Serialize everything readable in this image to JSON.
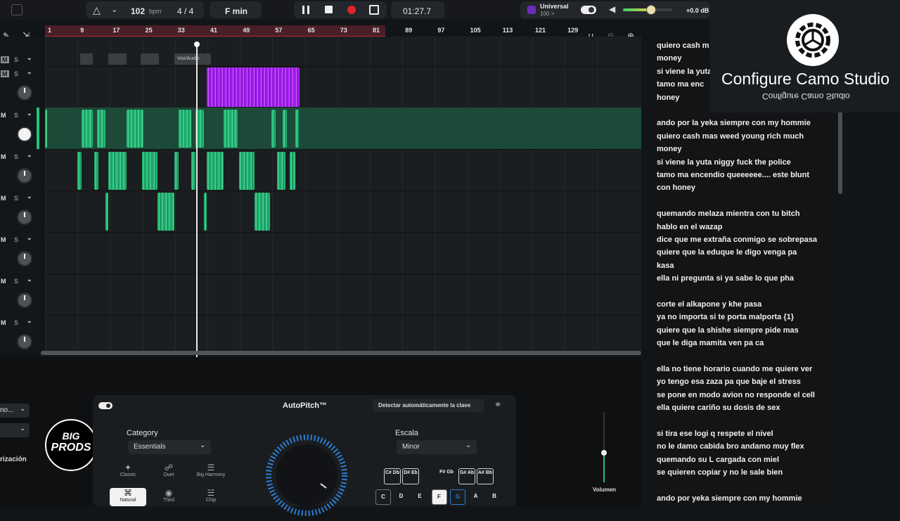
{
  "transport": {
    "bpm_value": "102",
    "bpm_unit": "bpm",
    "time_signature": "4 / 4",
    "key": "F min",
    "time": "01:27.7",
    "universal_label": "Universal",
    "universal_value": "100 >",
    "master_gain": "+0.0 dB",
    "volume_level": 0.55
  },
  "ruler": {
    "ticks": [
      "1",
      "9",
      "17",
      "25",
      "33",
      "41",
      "49",
      "57",
      "65",
      "73",
      "81",
      "89",
      "97",
      "105",
      "113",
      "121",
      "129"
    ]
  },
  "timeline": {
    "clip_label": "Voz/Audio"
  },
  "tracks": [
    {
      "m": "M",
      "s": "S"
    },
    {
      "m": "M",
      "s": "S"
    },
    {
      "m": "M",
      "s": "S"
    },
    {
      "m": "M",
      "s": "S"
    },
    {
      "m": "M",
      "s": "S"
    },
    {
      "m": "M",
      "s": "S"
    },
    {
      "m": "M",
      "s": "S"
    },
    {
      "m": "M",
      "s": "S"
    }
  ],
  "camo": {
    "title": "Configure Camo Studio",
    "subtitle": "Configure Camo Studio"
  },
  "lyrics": [
    "quiero cash m",
    "money",
    "si viene la yuta",
    " tamo ma enc",
    "honey",
    "",
    " ando por la  yeka siempre con my hommie",
    "quiero cash mas weed  young rich  much",
    "money",
    "si viene la yuta niggy fuck the police",
    " tamo ma encendio queeeeee.... este blunt",
    "con honey",
    "",
    "quemando melaza mientra con tu bitch",
    "hablo en el wazap",
    "dice que me extraña conmigo se sobrepasa",
    " quiere que la eduque le digo venga pa",
    "kasa",
    "ella ni pregunta si ya sabe lo que pha",
    "",
    " corte el alkapone y khe pasa",
    "ya no importa si te porta malporta {1}",
    "quiere que la shishe siempre pide mas",
    "que  le diga mamita ven  pa ca",
    "",
    "ella no tiene horario cuando me quiere ver",
    "yo tengo esa zaza pa que baje el stress",
    " se pone en  modo avion no responde el cell",
    "ella quiere cariño su dosis de sex",
    "",
    "si tira ese logi q respete el nivel",
    "no le damo cabida bro andamo muy flex",
    "quemando su L cargada con miel",
    "se quieren copiar y no le sale bien",
    "",
    "ando por yeka siempre con my hommie"
  ],
  "bottom": {
    "left_dropdown1": "no...",
    "left_label": "rización",
    "logo_text_1": "BIG",
    "logo_text_2": "PRODS",
    "plugin_title": "AutoPitch™",
    "detect_key": "Detectar automáticamente la clave",
    "category_label": "Category",
    "category_value": "Essentials",
    "scale_label": "Escala",
    "scale_value": "Minor",
    "styles": [
      "Classic",
      "Duet",
      "Big Harmony",
      "Natural",
      "Third",
      "Chip"
    ],
    "sharps": [
      "C#\nDb",
      "D#\nEb",
      "F#\nGb",
      "G#\nAb",
      "A#\nBb"
    ],
    "naturals": [
      "C",
      "D",
      "E",
      "F",
      "G",
      "A",
      "B"
    ],
    "volume_label": "Volumen",
    "colors": {
      "accent_green": "#22c37b",
      "accent_purple": "#a020f0",
      "record_red": "#e0242f",
      "selected_blue": "#2d7dd2"
    }
  }
}
